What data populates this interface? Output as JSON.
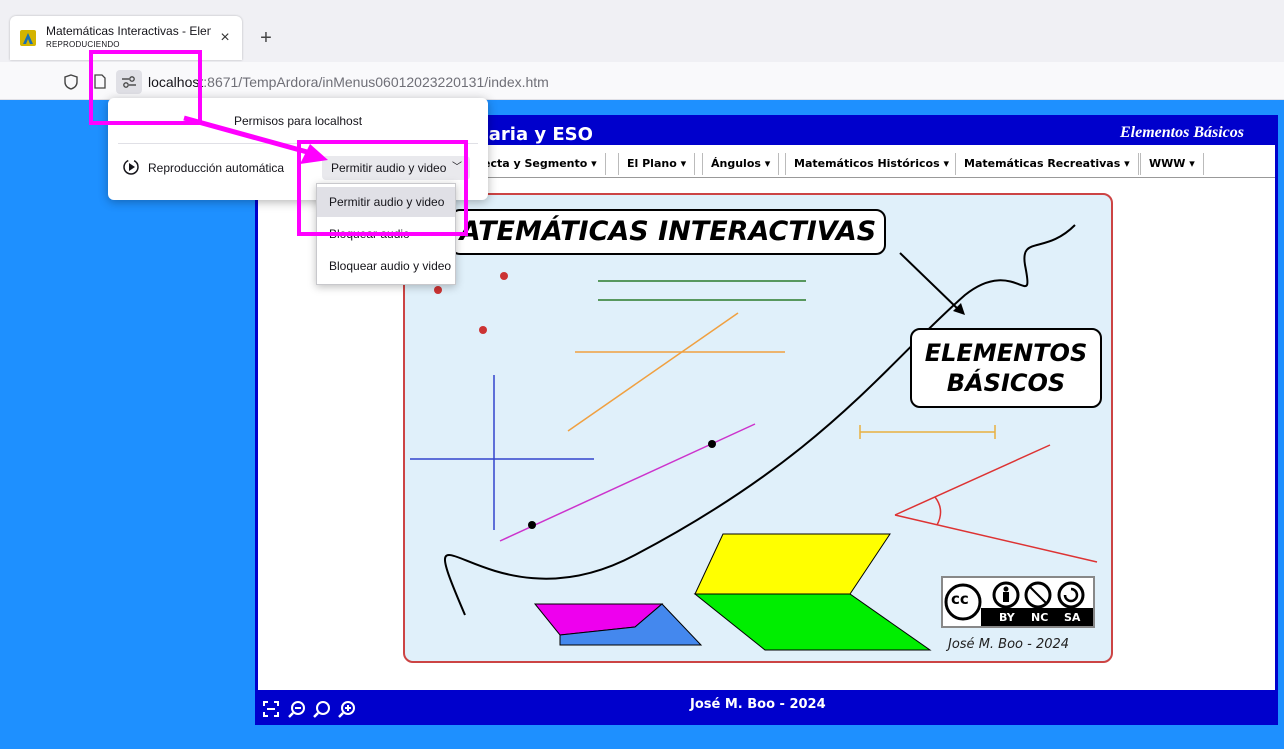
{
  "browser": {
    "tab_title": "Matemáticas Interactivas - Elem",
    "tab_subtitle": "REPRODUCIENDO",
    "close_glyph": "×",
    "new_tab_glyph": "+",
    "url_host": "localhost",
    "url_rest": ":8671/TempArdora/inMenus06012023220131/index.htm"
  },
  "permissions_popup": {
    "title": "Permisos para localhost",
    "autoplay_label": "Reproducción automática",
    "selected": "Permitir audio y video",
    "chevron": "﹀",
    "options": [
      "Permitir audio y video",
      "Bloquear audio",
      "Bloquear audio y video"
    ]
  },
  "page": {
    "header_title": "maria y ESO",
    "header_subtitle": "Elementos Básicos",
    "menu": [
      {
        "label": "ecta y Segmento ▾"
      },
      {
        "label": "El Plano ▾"
      },
      {
        "label": "Ángulos ▾"
      },
      {
        "label": "Matemáticos Históricos ▾"
      },
      {
        "label": "Matemáticas Recreativas ▾"
      },
      {
        "label": "WWW ▾"
      }
    ],
    "illustration": {
      "title": "ATEMÁTICAS INTERACTIVAS",
      "box_line1": "ELEMENTOS",
      "box_line2": "BÁSICOS"
    },
    "license": {
      "cc": "cc",
      "by": "BY",
      "nc": "NC",
      "sa": "SA",
      "author": "José M. Boo - 2024"
    },
    "footer_author": "José M. Boo - 2024"
  },
  "colors": {
    "page_bg": "#1e90ff",
    "frame": "#0000cc",
    "highlight": "#ff00ff"
  },
  "icons": [
    "shield-icon",
    "page-icon",
    "permissions-icon",
    "autoplay-icon",
    "fullscreen-icon",
    "zoom-out-icon",
    "zoom-reset-icon",
    "zoom-in-icon"
  ]
}
